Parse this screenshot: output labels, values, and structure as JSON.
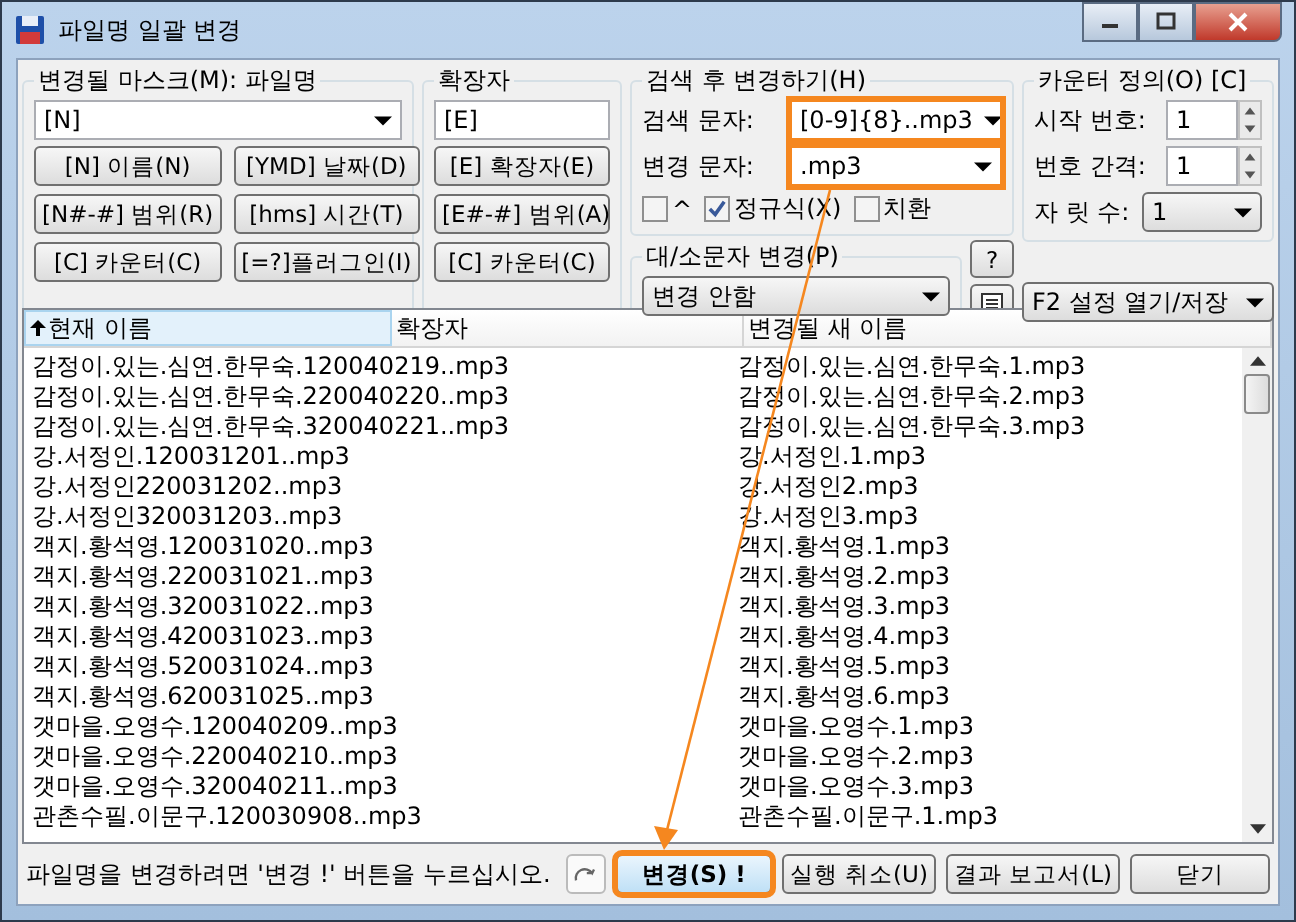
{
  "window": {
    "title": "파일명 일괄 변경"
  },
  "mask": {
    "label": "변경될 마스크(M): 파일명",
    "value": "[N]",
    "buttons": [
      "[N]  이름(N)",
      "[YMD] 날짜(D)",
      "[N#-#] 범위(R)",
      "[hms] 시간(T)",
      "[C] 카운터(C)",
      "[=?]플러그인(I)"
    ]
  },
  "extension": {
    "label": "확장자",
    "value": "[E]",
    "buttons": [
      "[E]  확장자(E)",
      "[E#-#] 범위(A)",
      "[C] 카운터(C)"
    ]
  },
  "search_replace": {
    "label": "검색 후 변경하기(H)",
    "search_label": "검색 문자:",
    "search_value": "[0-9]{8}..mp3",
    "search_highlighted": true,
    "replace_label": "변경 문자:",
    "replace_value": ".mp3",
    "replace_highlighted": true,
    "options": [
      {
        "label": "^",
        "checked": false
      },
      {
        "label": "정규식(X)",
        "checked": true
      },
      {
        "label": "치환",
        "checked": false
      }
    ]
  },
  "case": {
    "label": "대/소문자 변경(P)",
    "value": "변경 안함",
    "help_button": "?"
  },
  "counter": {
    "label": "카운터 정의(O) [C]",
    "start_label": "시작 번호:",
    "start_value": "1",
    "step_label": "번호 간격:",
    "step_value": "1",
    "digits_label": "자 릿 수:",
    "digits_value": "1",
    "settings": "F2 설정 열기/저장"
  },
  "table": {
    "columns": [
      {
        "label": "현재 이름",
        "sorted": true
      },
      {
        "label": "확장자",
        "sorted": false
      },
      {
        "label": "변경될 새 이름",
        "sorted": false
      }
    ],
    "rows": [
      [
        "감정이.있는.심연.한무숙.120040219..mp3",
        "감정이.있는.심연.한무숙.1.mp3"
      ],
      [
        "감정이.있는.심연.한무숙.220040220..mp3",
        "감정이.있는.심연.한무숙.2.mp3"
      ],
      [
        "감정이.있는.심연.한무숙.320040221..mp3",
        "감정이.있는.심연.한무숙.3.mp3"
      ],
      [
        "강.서정인.120031201..mp3",
        "강.서정인.1.mp3"
      ],
      [
        "강.서정인220031202..mp3",
        "강.서정인2.mp3"
      ],
      [
        "강.서정인320031203..mp3",
        "강.서정인3.mp3"
      ],
      [
        "객지.황석영.120031020..mp3",
        "객지.황석영.1.mp3"
      ],
      [
        "객지.황석영.220031021..mp3",
        "객지.황석영.2.mp3"
      ],
      [
        "객지.황석영.320031022..mp3",
        "객지.황석영.3.mp3"
      ],
      [
        "객지.황석영.420031023..mp3",
        "객지.황석영.4.mp3"
      ],
      [
        "객지.황석영.520031024..mp3",
        "객지.황석영.5.mp3"
      ],
      [
        "객지.황석영.620031025..mp3",
        "객지.황석영.6.mp3"
      ],
      [
        "갯마을.오영수.120040209..mp3",
        "갯마을.오영수.1.mp3"
      ],
      [
        "갯마을.오영수.220040210..mp3",
        "갯마을.오영수.2.mp3"
      ],
      [
        "갯마을.오영수.320040211..mp3",
        "갯마을.오영수.3.mp3"
      ],
      [
        "관촌수필.이문구.120030908..mp3",
        "관촌수필.이문구.1.mp3"
      ]
    ]
  },
  "status": "파일명을 변경하려면 '변경 !' 버튼을 누르십시오.",
  "buttons": [
    {
      "label": "변경(S) !",
      "kind": "primary",
      "highlighted": true
    },
    {
      "label": "실행 취소(U)",
      "kind": "normal",
      "highlighted": false
    },
    {
      "label": "결과 보고서(L)",
      "kind": "normal",
      "highlighted": false
    },
    {
      "label": "닫기",
      "kind": "wide",
      "highlighted": false
    }
  ]
}
